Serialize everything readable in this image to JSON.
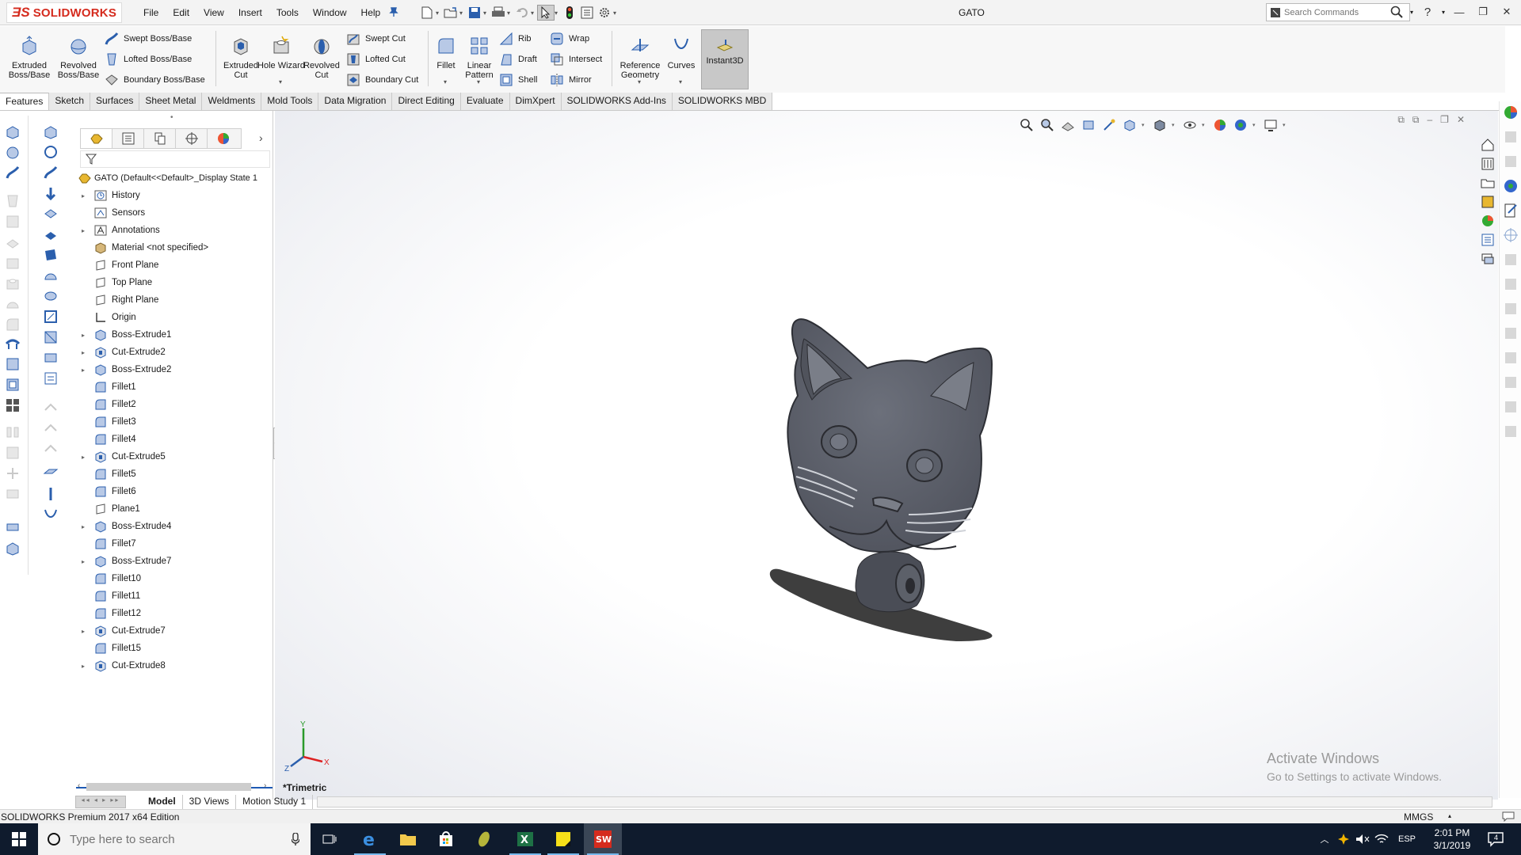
{
  "app": {
    "brand": "SOLIDWORKS",
    "document_title": "GATO",
    "menus": [
      "File",
      "Edit",
      "View",
      "Insert",
      "Tools",
      "Window",
      "Help"
    ],
    "search_placeholder": "Search Commands",
    "help_glyph": "?"
  },
  "commands": {
    "extruded_boss": "Extruded Boss/Base",
    "revolved_boss": "Revolved Boss/Base",
    "swept_boss": "Swept Boss/Base",
    "lofted_boss": "Lofted Boss/Base",
    "boundary_boss": "Boundary Boss/Base",
    "extruded_cut": "Extruded Cut",
    "hole_wizard": "Hole Wizard",
    "revolved_cut": "Revolved Cut",
    "swept_cut": "Swept Cut",
    "lofted_cut": "Lofted Cut",
    "boundary_cut": "Boundary Cut",
    "fillet": "Fillet",
    "linear_pattern": "Linear Pattern",
    "rib": "Rib",
    "draft": "Draft",
    "shell": "Shell",
    "wrap": "Wrap",
    "intersect": "Intersect",
    "mirror": "Mirror",
    "reference_geometry": "Reference Geometry",
    "curves": "Curves",
    "instant3d": "Instant3D"
  },
  "tabs": [
    {
      "label": "Features",
      "active": true
    },
    {
      "label": "Sketch"
    },
    {
      "label": "Surfaces"
    },
    {
      "label": "Sheet Metal"
    },
    {
      "label": "Weldments"
    },
    {
      "label": "Mold Tools"
    },
    {
      "label": "Data Migration"
    },
    {
      "label": "Direct Editing"
    },
    {
      "label": "Evaluate"
    },
    {
      "label": "DimXpert"
    },
    {
      "label": "SOLIDWORKS Add-Ins"
    },
    {
      "label": "SOLIDWORKS MBD"
    }
  ],
  "feature_tree": {
    "root": "GATO  (Default<<Default>_Display State 1",
    "nodes": [
      {
        "label": "History",
        "icon": "history-icon",
        "expandable": true
      },
      {
        "label": "Sensors",
        "icon": "sensors-icon",
        "expandable": false
      },
      {
        "label": "Annotations",
        "icon": "annotations-icon",
        "expandable": true
      },
      {
        "label": "Material <not specified>",
        "icon": "material-icon",
        "expandable": false
      },
      {
        "label": "Front Plane",
        "icon": "plane-icon",
        "expandable": false
      },
      {
        "label": "Top Plane",
        "icon": "plane-icon",
        "expandable": false
      },
      {
        "label": "Right Plane",
        "icon": "plane-icon",
        "expandable": false
      },
      {
        "label": "Origin",
        "icon": "origin-icon",
        "expandable": false
      },
      {
        "label": "Boss-Extrude1",
        "icon": "boss-extrude-icon",
        "expandable": true
      },
      {
        "label": "Cut-Extrude2",
        "icon": "cut-extrude-icon",
        "expandable": true
      },
      {
        "label": "Boss-Extrude2",
        "icon": "boss-extrude-icon",
        "expandable": true
      },
      {
        "label": "Fillet1",
        "icon": "fillet-icon",
        "expandable": false
      },
      {
        "label": "Fillet2",
        "icon": "fillet-icon",
        "expandable": false
      },
      {
        "label": "Fillet3",
        "icon": "fillet-icon",
        "expandable": false
      },
      {
        "label": "Fillet4",
        "icon": "fillet-icon",
        "expandable": false
      },
      {
        "label": "Cut-Extrude5",
        "icon": "cut-extrude-icon",
        "expandable": true
      },
      {
        "label": "Fillet5",
        "icon": "fillet-icon",
        "expandable": false
      },
      {
        "label": "Fillet6",
        "icon": "fillet-icon",
        "expandable": false
      },
      {
        "label": "Plane1",
        "icon": "plane-icon",
        "expandable": false
      },
      {
        "label": "Boss-Extrude4",
        "icon": "boss-extrude-icon",
        "expandable": true
      },
      {
        "label": "Fillet7",
        "icon": "fillet-icon",
        "expandable": false
      },
      {
        "label": "Boss-Extrude7",
        "icon": "boss-extrude-icon",
        "expandable": true
      },
      {
        "label": "Fillet10",
        "icon": "fillet-icon",
        "expandable": false
      },
      {
        "label": "Fillet11",
        "icon": "fillet-icon",
        "expandable": false
      },
      {
        "label": "Fillet12",
        "icon": "fillet-icon",
        "expandable": false
      },
      {
        "label": "Cut-Extrude7",
        "icon": "cut-extrude-icon",
        "expandable": true
      },
      {
        "label": "Fillet15",
        "icon": "fillet-icon",
        "expandable": false
      },
      {
        "label": "Cut-Extrude8",
        "icon": "cut-extrude-icon",
        "expandable": true
      }
    ]
  },
  "viewport": {
    "view_name": "*Trimetric",
    "triad": {
      "x": "X",
      "y": "Y",
      "z": "Z"
    },
    "watermark_title": "Activate Windows",
    "watermark_sub": "Go to Settings to activate Windows."
  },
  "bottom_tabs": [
    "Model",
    "3D Views",
    "Motion Study 1"
  ],
  "status": {
    "edition": "SOLIDWORKS Premium 2017 x64 Edition",
    "units": "MMGS"
  },
  "taskbar": {
    "search_placeholder": "Type here to search",
    "language": "ESP",
    "time": "2:01 PM",
    "date": "3/1/2019",
    "notification_count": "4"
  },
  "colors": {
    "brand_red": "#d52b1e",
    "model_body": "#5f636e",
    "taskbar": "#0f1b2d"
  }
}
